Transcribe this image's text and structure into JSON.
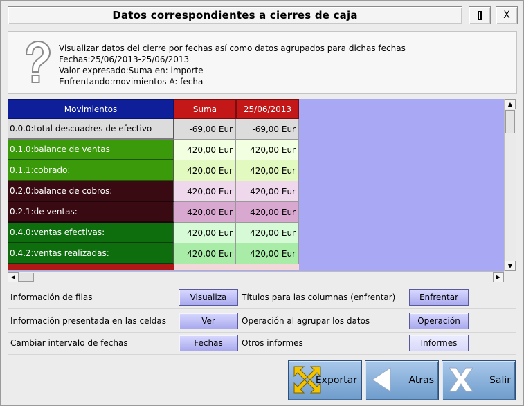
{
  "window": {
    "title": "Datos correspondientes a cierres de caja",
    "max_label": "",
    "close_label": "X"
  },
  "info": {
    "icon": "question-icon",
    "lines": [
      "Visualizar datos del cierre por fechas así como datos agrupados para dichas fechas",
      "Fechas:25/06/2013-25/06/2013",
      "Valor expresado:Suma en: importe",
      "Enfrentando:movimientos A: fecha"
    ]
  },
  "table": {
    "headers": [
      "Movimientos",
      "Suma",
      "25/06/2013"
    ],
    "rows": [
      {
        "label": "0.0.0:total descuadres de efectivo",
        "suma": "-69,00 Eur",
        "fecha": "-69,00 Eur",
        "label_bg": "#dcdcdc",
        "label_fg": "#000000",
        "suma_bg": "#dcdcdc",
        "fecha_bg": "#dcdcdc"
      },
      {
        "label": "0.1.0:balance de ventas",
        "suma": "420,00 Eur",
        "fecha": "420,00 Eur",
        "label_bg": "#3a9a0a",
        "label_fg": "#ffffff",
        "suma_bg": "#f2ffe0",
        "fecha_bg": "#f2ffe0"
      },
      {
        "label": "0.1.1:cobrado:",
        "suma": "420,00 Eur",
        "fecha": "420,00 Eur",
        "label_bg": "#3a9a0a",
        "label_fg": "#ffffff",
        "suma_bg": "#e2fac0",
        "fecha_bg": "#e2fac0"
      },
      {
        "label": "0.2.0:balance de cobros:",
        "suma": "420,00 Eur",
        "fecha": "420,00 Eur",
        "label_bg": "#3a0a12",
        "label_fg": "#ffffff",
        "suma_bg": "#f0d8ec",
        "fecha_bg": "#f0d8ec"
      },
      {
        "label": "0.2.1:de ventas:",
        "suma": "420,00 Eur",
        "fecha": "420,00 Eur",
        "label_bg": "#3a0a12",
        "label_fg": "#ffffff",
        "suma_bg": "#d8a8d0",
        "fecha_bg": "#d8a8d0"
      },
      {
        "label": "0.4.0:ventas efectivas:",
        "suma": "420,00 Eur",
        "fecha": "420,00 Eur",
        "label_bg": "#0e6e0e",
        "label_fg": "#ffffff",
        "suma_bg": "#d6fad6",
        "fecha_bg": "#d6fad6"
      },
      {
        "label": "0.4.2:ventas realizadas:",
        "suma": "420,00 Eur",
        "fecha": "420,00 Eur",
        "label_bg": "#0e6e0e",
        "label_fg": "#ffffff",
        "suma_bg": "#a8eca8",
        "fecha_bg": "#a8eca8"
      }
    ],
    "partial_row": {
      "label_bg": "#b01818",
      "value_bg": "#f2d8d8"
    },
    "grid_bg": "#a8a8f4"
  },
  "options": [
    {
      "label": "Información de filas",
      "button": "Visualiza",
      "label2": "Títulos para las columnas (enfrentar)",
      "button2": "Enfrentar"
    },
    {
      "label": "Información presentada en las celdas",
      "button": "Ver",
      "label2": "Operación al agrupar los datos",
      "button2": "Operación"
    },
    {
      "label": "Cambiar intervalo de fechas",
      "button": "Fechas",
      "label2": "Otros informes",
      "button2": "Informes"
    }
  ],
  "actions": {
    "export_label": "Exportar",
    "export_icon": "export-arrows-icon",
    "back_label": "Atras",
    "back_icon": "arrow-left-icon",
    "exit_label": "Salir",
    "exit_icon": "x-icon"
  }
}
